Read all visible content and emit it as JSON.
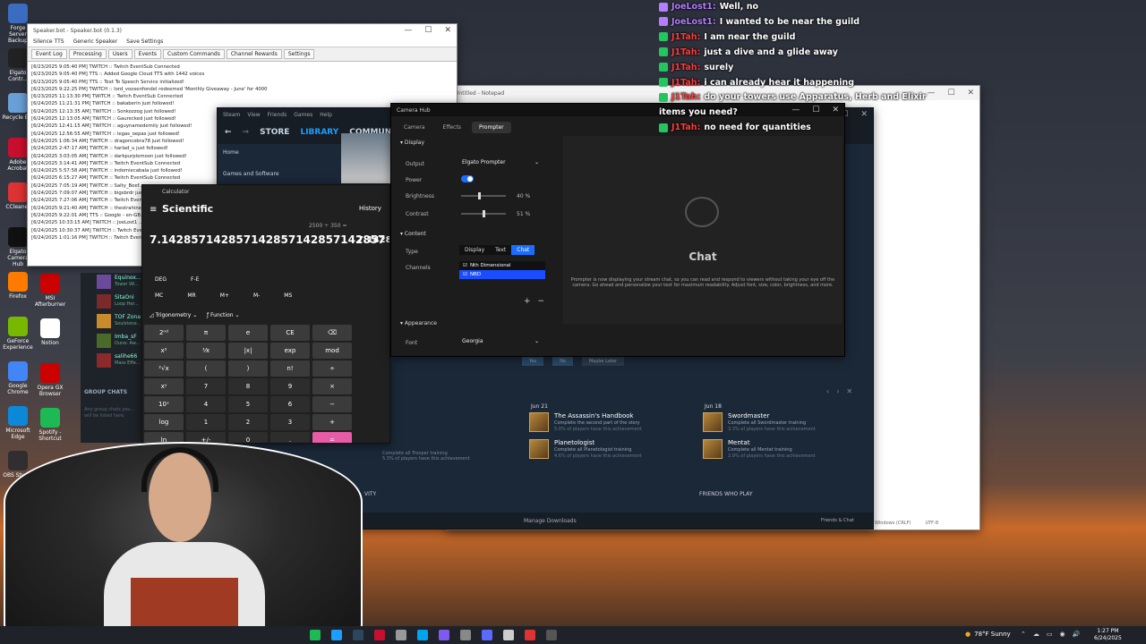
{
  "colors": {
    "accent_blue": "#1a6dff",
    "steam_bg": "#1b2838",
    "cam_bg": "#1c1c1c",
    "chat_name_purple": "#b57dff",
    "chat_name_red": "#ff3c3c",
    "check_green": "#22c55e"
  },
  "desktop_icons": [
    {
      "label": "Forge Server Backup",
      "color": "#3a6cc0"
    },
    {
      "label": "Elgato Contr...",
      "color": "#222"
    },
    {
      "label": "Recycle Bin",
      "color": "#6aa0d8"
    },
    {
      "label": "Adobe Acrobat",
      "color": "#c8102e"
    },
    {
      "label": "CCleaner",
      "color": "#d33"
    },
    {
      "label": "Elgato Camera Hub",
      "color": "#111"
    },
    {
      "label": "Firefox",
      "color": "#ff7a00"
    },
    {
      "label": "GeForce Experience",
      "color": "#76b900"
    },
    {
      "label": "Google Chrome",
      "color": "#4285f4"
    },
    {
      "label": "Microsoft Edge",
      "color": "#0c88d8"
    },
    {
      "label": "OBS Studio",
      "color": "#302e31"
    }
  ],
  "desktop_icons_col2": [
    {
      "label": "MSI Afterburner",
      "color": "#c00"
    },
    {
      "label": "Notion",
      "color": "#fff"
    },
    {
      "label": "Opera GX Browser",
      "color": "#c00"
    },
    {
      "label": "Spotify - Shortcut",
      "color": "#1db954"
    }
  ],
  "speaker_bot": {
    "title": "Speaker.bot - Speaker.bot (0.1.3)",
    "menu": [
      "Silence TTS",
      "Generic Speaker",
      "Save Settings"
    ],
    "tabs": [
      "Event Log",
      "Processing",
      "Users",
      "Events",
      "Custom Commands",
      "Channel Rewards",
      "Settings"
    ],
    "log": [
      "[6/23/2025 9:05:40 PM] TWITCH :: Twitch EventSub Connected",
      "[6/23/2025 9:05:40 PM] TTS :: Added Google Cloud TTS with 1442 voices",
      "[6/23/2025 9:05:40 PM] TTS :: Text To Speech Service initialized!",
      "[6/23/2025 9:22:25 PM] TWITCH :: lord_voosenfondel redeemed 'Monthly Giveaway - June' for 4000",
      "[6/23/2025 11:13:30 PM] TWITCH :: Twitch EventSub Connected",
      "[6/24/2025 11:21:31 PM] TWITCH :: bakaberin just followed!",
      "[6/24/2025 12:13:35 AM] TWITCH :: Sonkozzog just followed!",
      "[6/24/2025 12:13:05 AM] TWITCH :: Gaurecked just followed!",
      "[6/24/2025 12:41:15 AM] TWITCH :: aguynamedemily just followed!",
      "[6/24/2025 12:56:55 AM] TWITCH :: legas_oepas just followed!",
      "[6/24/2025 1:06:34 AM] TWITCH :: dragoncobra78 just followed!",
      "[6/24/2025 2:47:17 AM] TWITCH :: harlad_u just followed!",
      "[6/24/2025 3:03:05 AM] TWITCH :: darkpurplemoon just followed!",
      "[6/24/2025 3:14:41 AM] TWITCH :: Twitch EventSub Connected",
      "[6/24/2025 5:57:58 AM] TWITCH :: indomiecabala just followed!",
      "[6/24/2025 6:15:27 AM] TWITCH :: Twitch EventSub Connected",
      "[6/24/2025 7:05:19 AM] TWITCH :: Salty_Beef...",
      "[6/24/2025 7:09:07 AM] TWITCH :: bigsbrdr jus...",
      "[6/24/2025 7:27:06 AM] TWITCH :: Twitch Even...",
      "[6/24/2025 9:21:40 AM] TWITCH :: thestrahiner...",
      "[6/24/2025 9:22:01 AM] TTS :: Google - en-GB...",
      "[6/24/2025 10:33:15 AM] TWITCH :: JoeLost1 ...",
      "[6/24/2025 10:30:37 AM] TWITCH :: Twitch Even...",
      "[6/24/2025 1:01:16 PM] TWITCH :: Twitch Even..."
    ]
  },
  "steam": {
    "title": "Steam",
    "menu": [
      "Steam",
      "View",
      "Friends",
      "Games",
      "Help"
    ],
    "nav": [
      "STORE",
      "LIBRARY",
      "COMMUNITY"
    ],
    "home": "Home",
    "filter": "Games and Software",
    "friends": [
      {
        "name": "Equinox...",
        "status": "Tower Wi...",
        "color": "#6a4a9a"
      },
      {
        "name": "SitaOni",
        "status": "Loop Her...",
        "color": "#7a2a2a"
      },
      {
        "name": "TOF Zona",
        "status": "Soulstone...",
        "color": "#c88a2a"
      },
      {
        "name": "Imba_sF",
        "status": "Dune: Aw...",
        "color": "#4a6a2a"
      },
      {
        "name": "salihe66",
        "status": "Mass Effe...",
        "color": "#8a2a2a"
      }
    ],
    "group_chats": "GROUP CHATS",
    "group_hint": "Any group chats you... will be listed here.",
    "achievements": {
      "col1_date": "Jun 21",
      "col1": [
        {
          "title": "The Assassin's Handbook",
          "desc": "Complete the second part of the story",
          "pct": "5.0% of players have this achievement"
        },
        {
          "title": "Planetologist",
          "desc": "Complete all Planetologist training",
          "pct": "4.6% of players have this achievement"
        }
      ],
      "col2_date": "Jun 18",
      "col2": [
        {
          "title": "Swordmaster",
          "desc": "Complete all Swordmaster training",
          "pct": "3.3% of players have this achievement"
        },
        {
          "title": "Mentat",
          "desc": "Complete all Mentat training",
          "pct": "2.9% of players have this achievement"
        }
      ],
      "prev_desc": "Complete all Trooper training",
      "prev_pct": "5.3% of players have this achievement"
    },
    "friends_who_play": "FRIENDS WHO PLAY",
    "activity": "VITY",
    "manage_downloads": "Manage Downloads",
    "friends_chat": "Friends & Chat",
    "yes": "Yes",
    "no": "No",
    "maybe": "Maybe Later"
  },
  "calculator": {
    "title": "Calculator",
    "mode": "Scientific",
    "history": "History",
    "expression": "2500 ÷ 350 =",
    "result": "7.142857142857142857142857142857",
    "history_partial": "7.14285",
    "deg": "DEG",
    "fe": "F-E",
    "memory": [
      "MC",
      "MR",
      "M+",
      "M-",
      "MS"
    ],
    "trig": "Trigonometry",
    "func": "Function",
    "rows": [
      [
        "2ⁿᵈ",
        "π",
        "e",
        "CE",
        "⌫"
      ],
      [
        "x²",
        "⅟x",
        "|x|",
        "exp",
        "mod"
      ],
      [
        "²√x",
        "(",
        ")",
        "n!",
        "÷"
      ],
      [
        "xʸ",
        "7",
        "8",
        "9",
        "×"
      ],
      [
        "10ˣ",
        "4",
        "5",
        "6",
        "−"
      ],
      [
        "log",
        "1",
        "2",
        "3",
        "+"
      ],
      [
        "ln",
        "+/-",
        "0",
        ".",
        "="
      ]
    ]
  },
  "camera_hub": {
    "title": "Camera Hub",
    "tabs": [
      "Camera",
      "Effects",
      "Prompter"
    ],
    "display_section": "Display",
    "output_label": "Output",
    "output_value": "Elgato Prompter",
    "power_label": "Power",
    "brightness_label": "Brightness",
    "brightness_value": "40 %",
    "brightness_level": 0.4,
    "contrast_label": "Contrast",
    "contrast_value": "51 %",
    "contrast_level": 0.51,
    "content_section": "Content",
    "type_label": "Type",
    "type_options": [
      "Display",
      "Text",
      "Chat"
    ],
    "type_selected": "Chat",
    "channels_label": "Channels",
    "channels": [
      "Nth Dimensional",
      "NBD"
    ],
    "appearance_section": "Appearance",
    "font_label": "Font",
    "font_value": "Georgia",
    "preview_title": "Chat",
    "preview_desc": "Prompter is now displaying your stream chat, so you can read and respond to viewers without taking your eye off the camera. Go ahead and personalize your text for maximum readability. Adjust font, size, color, brightness, and more."
  },
  "notepad": {
    "title": "*Untitled - Notepad",
    "status_encoding": "Windows (CRLF)",
    "status_charset": "UTF-8"
  },
  "twitch_chat": [
    {
      "user": "JoeLost1",
      "msg": "Well, no",
      "icon": "purple"
    },
    {
      "user": "JoeLost1",
      "msg": "I wanted to be near the guild",
      "icon": "purple"
    },
    {
      "user": "J1Tah",
      "msg": "I am near the guild",
      "icon": "green"
    },
    {
      "user": "J1Tah",
      "msg": "just a dive and a glide away",
      "icon": "green"
    },
    {
      "user": "J1Tah",
      "msg": "surely",
      "icon": "green"
    },
    {
      "user": "J1Tah",
      "msg": "i can already hear it happening",
      "icon": "green"
    },
    {
      "user": "J1Tah",
      "msg": "do your towers use Apparatus, Herb and Elixir",
      "icon": "green"
    },
    {
      "user": "",
      "msg": "items you need?",
      "icon": "none"
    },
    {
      "user": "J1Tah",
      "msg": "no need for quantities",
      "icon": "green"
    }
  ],
  "taskbar": {
    "weather": "78°F Sunny",
    "time": "1:27 PM",
    "date": "6/24/2025"
  }
}
